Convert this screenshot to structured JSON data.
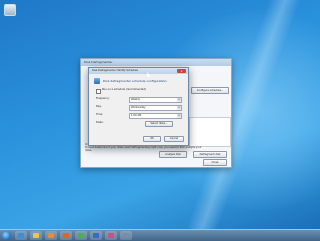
{
  "colors": {
    "desktop": "#2a92dc",
    "taskbar": "#3f6488",
    "dialog_title": "#bcd2ea",
    "close_button": "#c7463e"
  },
  "icons": {
    "recycle_bin": "recycle-bin-icon",
    "start": "windows-start-icon",
    "taskbar": [
      "ie-icon",
      "folder-icon",
      "media-player-icon",
      "firefox-icon",
      "chrome-icon",
      "outlook-icon",
      "paint-icon",
      "app-icon"
    ]
  },
  "back_window": {
    "title": "Disk Defragmenter",
    "button_top": "Configure schedule...",
    "note_line1": "Only disks that can be defragmented are shown.",
    "note_line2": "To best determine if your disks need defragmenting right now, you need to first analyze your disks.",
    "analyze_label": "Analyze disk",
    "defrag_label": "Defragment disk",
    "close_label": "Close"
  },
  "dialog": {
    "title": "Disk Defragmenter: Modify Schedule",
    "heading": "Disk defragmenter schedule configuration:",
    "run_on_schedule": "Run on a schedule (recommended)",
    "frequency_label": "Frequency:",
    "frequency_value": "Weekly",
    "day_label": "Day:",
    "day_value": "Wednesday",
    "time_label": "Time:",
    "time_value": "1:00 AM",
    "disks_label": "Disks:",
    "select_disks": "Select disks...",
    "ok": "OK",
    "cancel": "Cancel",
    "close_glyph": "x"
  }
}
